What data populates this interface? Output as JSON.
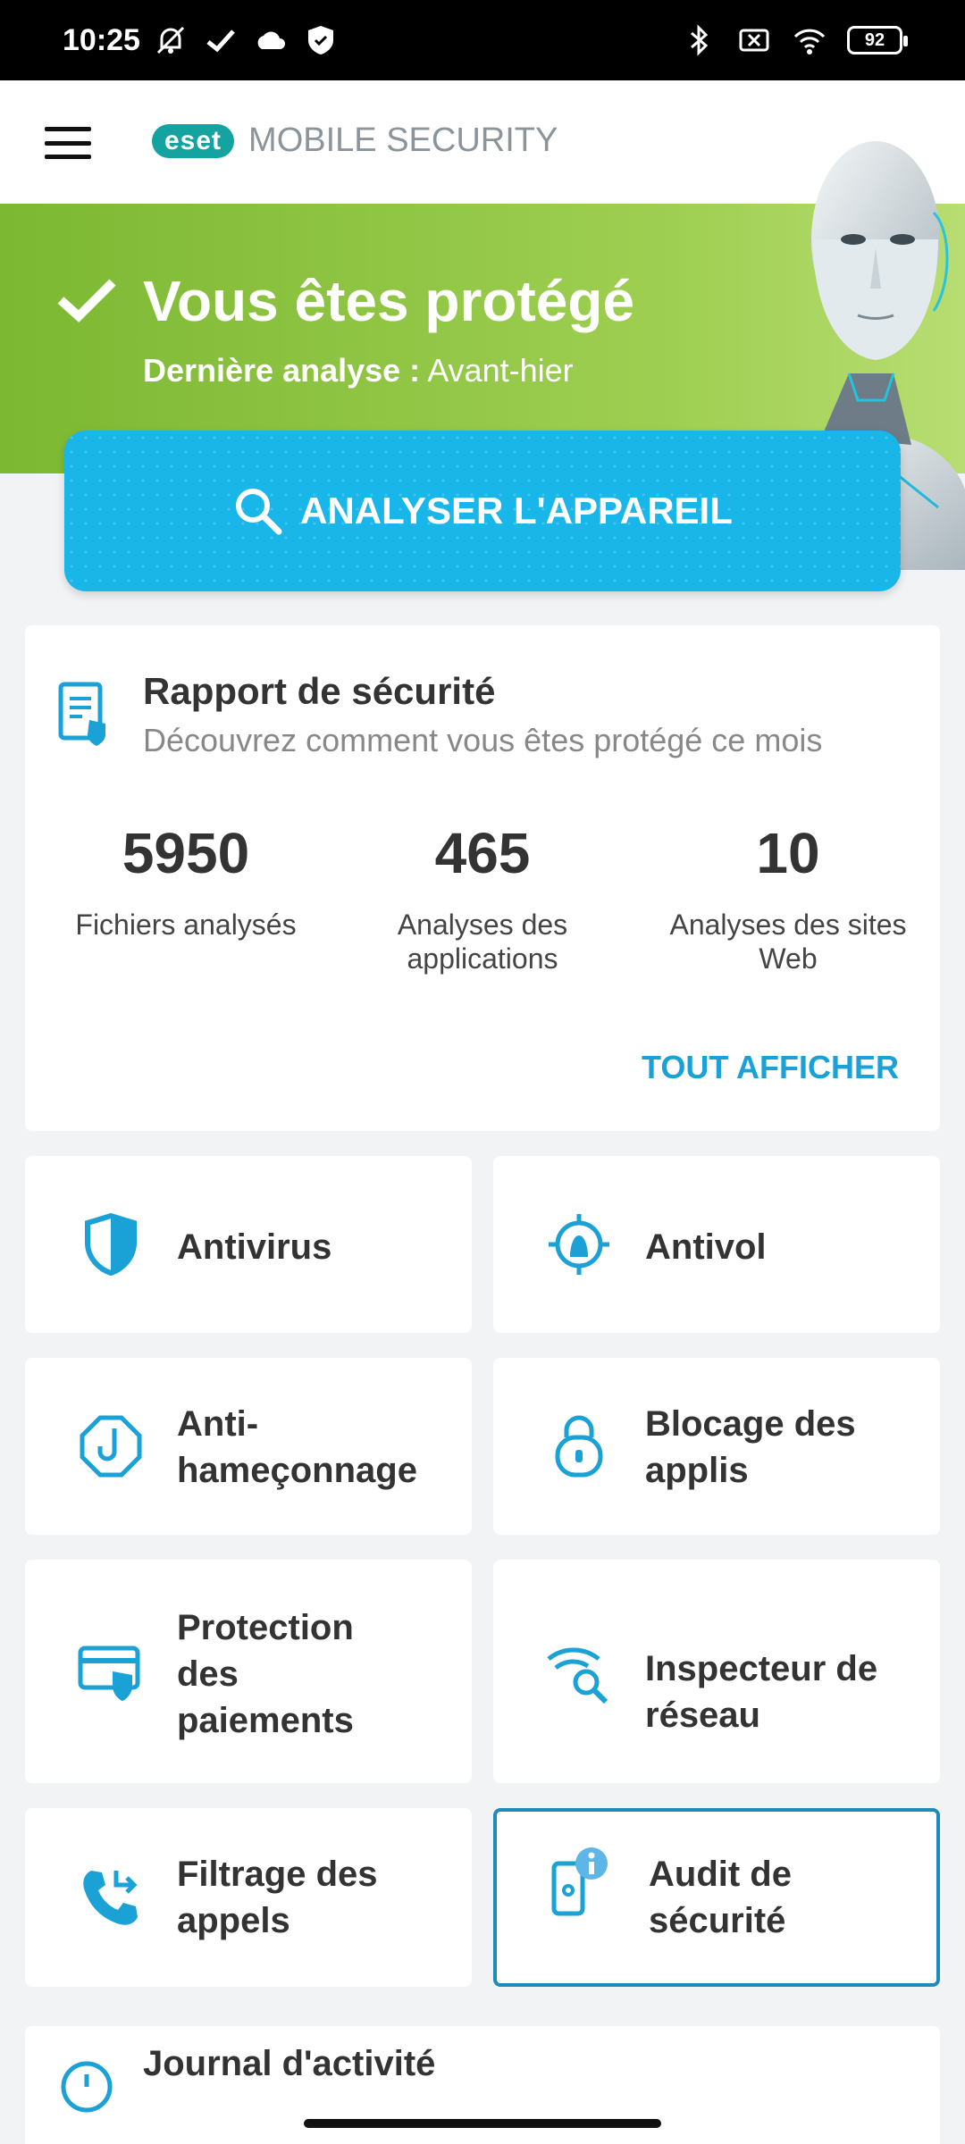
{
  "status_bar": {
    "time": "10:25",
    "battery": "92",
    "icons": [
      "mute-icon",
      "check-icon",
      "cloud-icon",
      "shield-icon",
      "bluetooth-icon",
      "sim-icon",
      "wifi-icon",
      "battery-icon"
    ]
  },
  "header": {
    "brand_logo": "eset",
    "brand_text": "MOBILE SECURITY"
  },
  "hero": {
    "title": "Vous êtes protégé",
    "last_scan_label": "Dernière analyse :",
    "last_scan_value": "Avant-hier",
    "scan_button": "ANALYSER L'APPAREIL"
  },
  "report": {
    "title": "Rapport de sécurité",
    "description": "Découvrez comment vous êtes protégé ce mois",
    "stats": [
      {
        "value": "5950",
        "label": "Fichiers analysés"
      },
      {
        "value": "465",
        "label": "Analyses des applications"
      },
      {
        "value": "10",
        "label": "Analyses des sites Web"
      }
    ],
    "view_all": "TOUT AFFICHER"
  },
  "features": [
    {
      "label": "Antivirus",
      "icon": "shield-icon"
    },
    {
      "label": "Antivol",
      "icon": "target-icon"
    },
    {
      "label": "Anti-hameçonnage",
      "icon": "hook-icon"
    },
    {
      "label": "Blocage des applis",
      "icon": "lock-icon"
    },
    {
      "label": "Protection des paiements",
      "icon": "card-icon"
    },
    {
      "label": "Inspecteur de réseau",
      "icon": "wifi-search-icon"
    },
    {
      "label": "Filtrage des appels",
      "icon": "phone-icon"
    },
    {
      "label": "Audit de sécurité",
      "icon": "phone-info-icon"
    }
  ],
  "journal": {
    "title": "Journal d'activité"
  },
  "colors": {
    "accent": "#1aa1d6",
    "hero_green": "#8cc63f",
    "scan_blue": "#19b6ea"
  }
}
